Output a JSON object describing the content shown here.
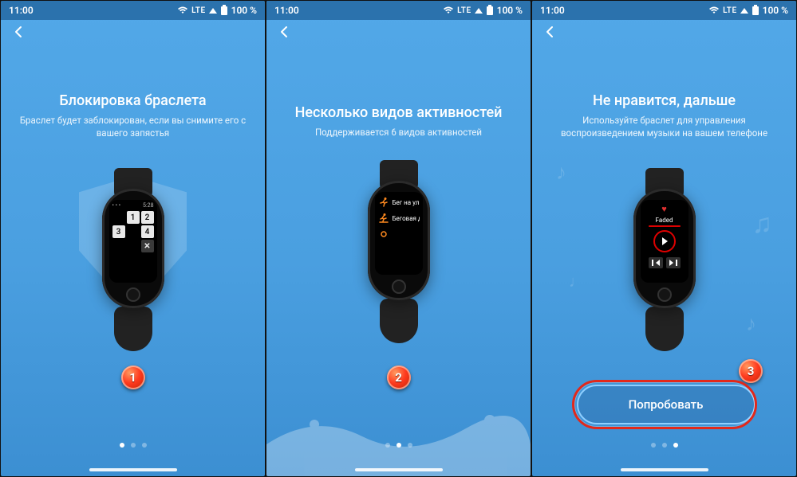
{
  "status": {
    "time": "11:00",
    "network": "LTE",
    "battery": "100 %"
  },
  "screens": [
    {
      "title": "Блокировка браслета",
      "subtitle": "Браслет будет заблокирован, если вы снимите его с вашего запястья",
      "badge": "1",
      "pad_time": "5:28",
      "keys": [
        "",
        "1",
        "2",
        "3",
        "",
        "4",
        "",
        "",
        "✕"
      ],
      "active_dot": 0
    },
    {
      "title": "Несколько видов активностей",
      "subtitle": "Поддерживается 6 видов активностей",
      "badge": "2",
      "activities": [
        "Бег на улиц",
        "Беговая до"
      ],
      "active_dot": 1
    },
    {
      "title": "Не нравится, дальше",
      "subtitle": "Используйте браслет для управления воспроизведением музыки на вашем телефоне",
      "badge": "3",
      "track": "Faded",
      "try_label": "Попробовать",
      "active_dot": 2
    }
  ]
}
